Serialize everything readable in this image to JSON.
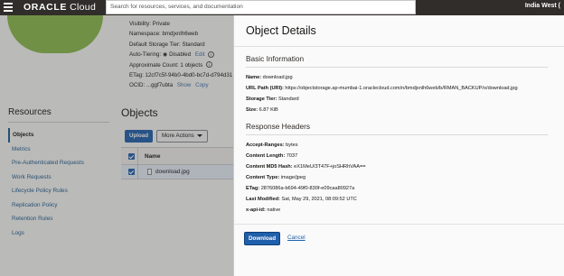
{
  "topbar": {
    "logo_brand": "ORACLE",
    "logo_product": "Cloud",
    "search_placeholder": "Search for resources, services, and documentation",
    "region": "India West (",
    "bg": "#312d2a"
  },
  "bucket_meta": {
    "visibility": "Visibility: Private",
    "namespace": "Namespace: bmdjxnlh6web",
    "storage_tier": "Default Storage Tier: Standard",
    "auto_tiering_label": "Auto-Tiering:",
    "auto_tiering_value": "Disabled",
    "auto_tiering_edit": "Edit",
    "approx_count": "Approximate Count: 1 objects",
    "etag": "ETag: 12cf7c5f-94b0-4bd0-bc7d-d794d31",
    "ocid_label": "OCID:",
    "ocid_value": "...ggf7ubta",
    "ocid_show": "Show",
    "ocid_copy": "Copy"
  },
  "resources": {
    "title": "Resources",
    "items": [
      {
        "label": "Objects",
        "active": true
      },
      {
        "label": "Metrics"
      },
      {
        "label": "Pre-Authenticated Requests"
      },
      {
        "label": "Work Requests"
      },
      {
        "label": "Lifecycle Policy Rules"
      },
      {
        "label": "Replication Policy"
      },
      {
        "label": "Retention Rules"
      },
      {
        "label": "Logs"
      }
    ]
  },
  "objects": {
    "title": "Objects",
    "upload_label": "Upload",
    "more_actions_label": "More Actions",
    "column_name": "Name",
    "rows": [
      {
        "name": "download.jpg"
      }
    ]
  },
  "drawer": {
    "title": "Object Details",
    "basic_info_title": "Basic Information",
    "name_label": "Name:",
    "name_value": "download.jpg",
    "url_label": "URL Path (URI):",
    "url_value": "https://objectstorage.ap-mumbai-1.oraclecloud.com/n/bmdjxnlh6web/b/RMAN_BACKUP/o/download.jpg",
    "storage_tier_label": "Storage Tier:",
    "storage_tier_value": "Standard",
    "size_label": "Size:",
    "size_value": "6.87 KiB",
    "response_headers_title": "Response Headers",
    "accept_ranges_label": "Accept-Ranges:",
    "accept_ranges_value": "bytes",
    "content_length_label": "Content Length:",
    "content_length_value": "7037",
    "content_md5_label": "Content MD5 Hash:",
    "content_md5_value": "eX1MeU/3T47F+joSHRhVAA==",
    "content_type_label": "Content Type:",
    "content_type_value": "image/jpeg",
    "etag_label": "ETag:",
    "etag_value": "2876086a-b694-49f0-830f-e09caa80927a",
    "last_modified_label": "Last Modified:",
    "last_modified_value": "Sat, May 29, 2021, 08:09:52 UTC",
    "api_id_label": "x-api-id:",
    "api_id_value": "native",
    "download_label": "Download",
    "cancel_label": "Cancel"
  },
  "colors": {
    "primary": "#1f5fab",
    "link": "#3c6ea7",
    "brand_green": "#8ab94a"
  }
}
